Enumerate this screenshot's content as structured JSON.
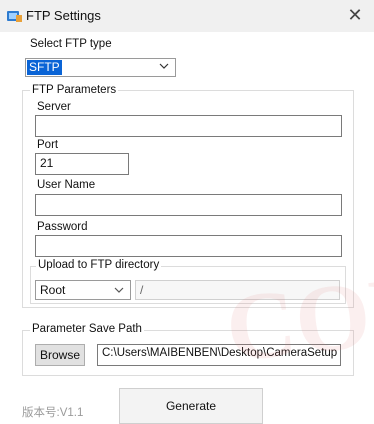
{
  "window": {
    "title": "FTP Settings",
    "close_glyph": "✕"
  },
  "ftp_type": {
    "label": "Select FTP type",
    "value": "SFTP"
  },
  "params": {
    "legend": "FTP Parameters",
    "server": {
      "label": "Server",
      "value": ""
    },
    "port": {
      "label": "Port",
      "value": "21"
    },
    "username": {
      "label": "User Name",
      "value": ""
    },
    "password": {
      "label": "Password",
      "value": ""
    },
    "upload": {
      "legend": "Upload to FTP directory",
      "select_value": "Root",
      "path_value": "/"
    }
  },
  "save": {
    "legend": "Parameter Save Path",
    "browse_label": "Browse",
    "path_value": "C:\\Users\\MAIBENBEN\\Desktop\\CameraSetup"
  },
  "generate_label": "Generate",
  "version": "版本号:V1.1",
  "colors": {
    "selection": "#0a64d6",
    "icon": "#2e7bcf"
  }
}
